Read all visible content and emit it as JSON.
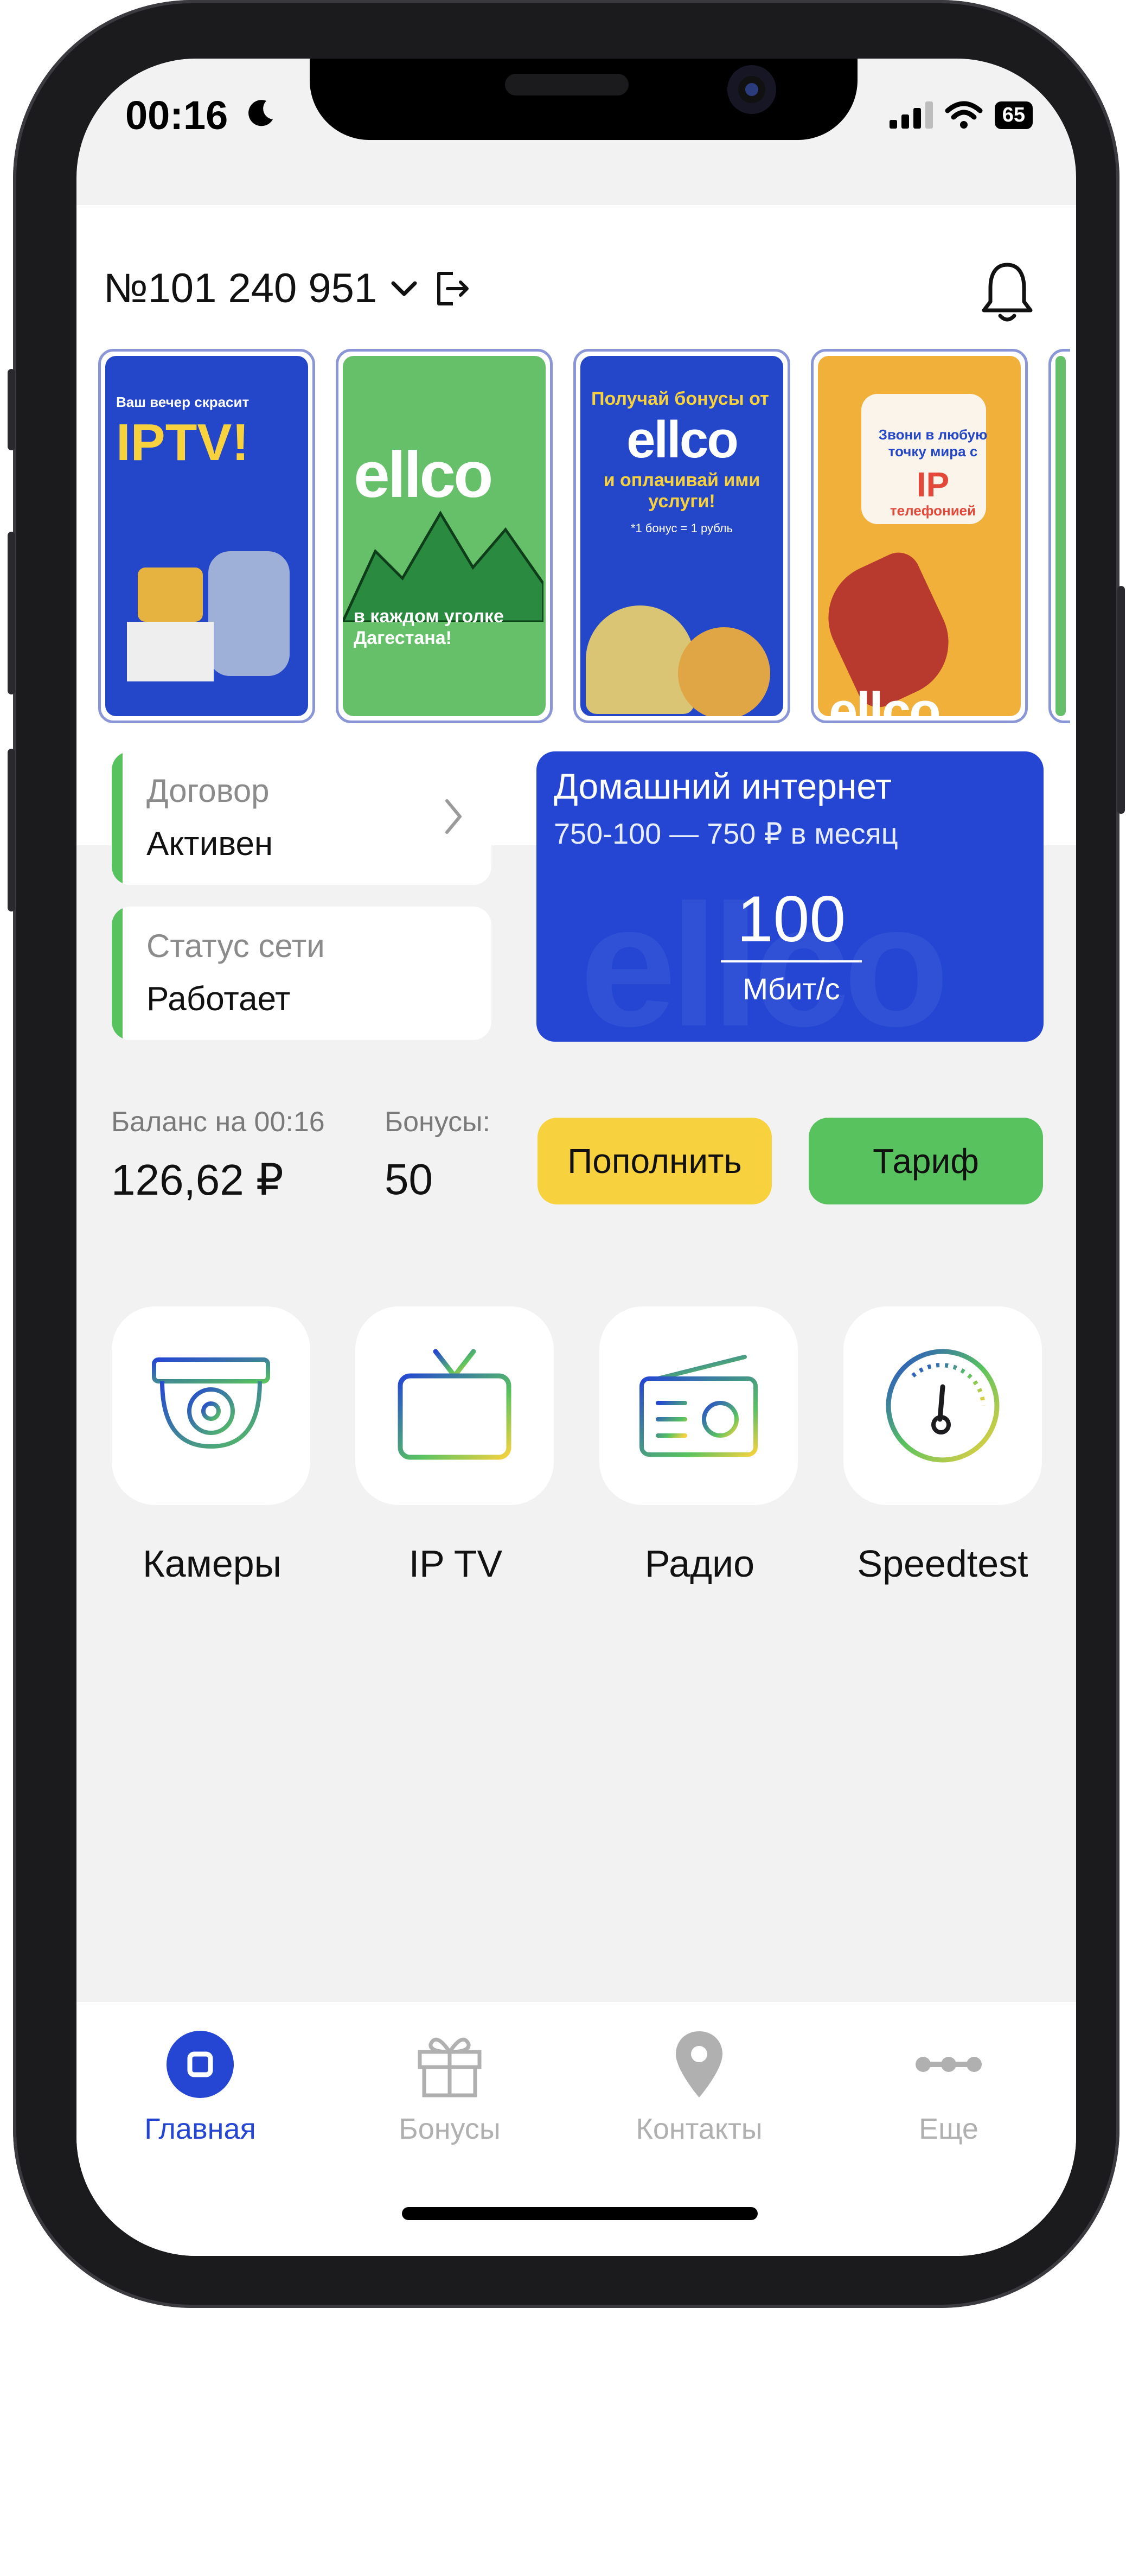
{
  "colors": {
    "accent_blue": "#2446d3",
    "green": "#58c25f",
    "yellow": "#f7d23e",
    "inactive": "#b0b0b0"
  },
  "status_bar": {
    "time": "00:16",
    "battery": "65"
  },
  "header": {
    "account_number": "№101 240 951"
  },
  "stories": [
    {
      "title": "IPTV!",
      "subtitle": "Ваш вечер скрасит"
    },
    {
      "title": "ellco",
      "caption": "в каждом уголке Дагестана!"
    },
    {
      "line1": "Получай бонусы от",
      "brand": "ellco",
      "line2": "и оплачивай ими услуги!",
      "note": "*1 бонус = 1 рубль"
    },
    {
      "line1": "Звони в любую точку мира с",
      "accent": "IP",
      "line2": "телефонией",
      "brand": "ellco"
    }
  ],
  "contract": {
    "label": "Договор",
    "value": "Активен"
  },
  "network": {
    "label": "Статус сети",
    "value": "Работает"
  },
  "plan": {
    "title": "Домашний интернет",
    "price": "750-100 — 750 ₽ в месяц",
    "speed": "100",
    "unit": "Мбит/с",
    "watermark": "ellco"
  },
  "balance": {
    "label": "Баланс на 00:16",
    "value": "126,62 ₽"
  },
  "bonuses": {
    "label": "Бонусы:",
    "value": "50"
  },
  "actions": {
    "topup": "Пополнить",
    "tariff": "Тариф"
  },
  "services": [
    {
      "label": "Камеры",
      "icon": "camera-icon"
    },
    {
      "label": "IP TV",
      "icon": "tv-icon"
    },
    {
      "label": "Радио",
      "icon": "radio-icon"
    },
    {
      "label": "Speedtest",
      "icon": "speedometer-icon"
    }
  ],
  "tabs": [
    {
      "label": "Главная",
      "icon": "home-icon",
      "active": true
    },
    {
      "label": "Бонусы",
      "icon": "gift-icon"
    },
    {
      "label": "Контакты",
      "icon": "location-pin-icon"
    },
    {
      "label": "Еще",
      "icon": "more-icon"
    }
  ]
}
